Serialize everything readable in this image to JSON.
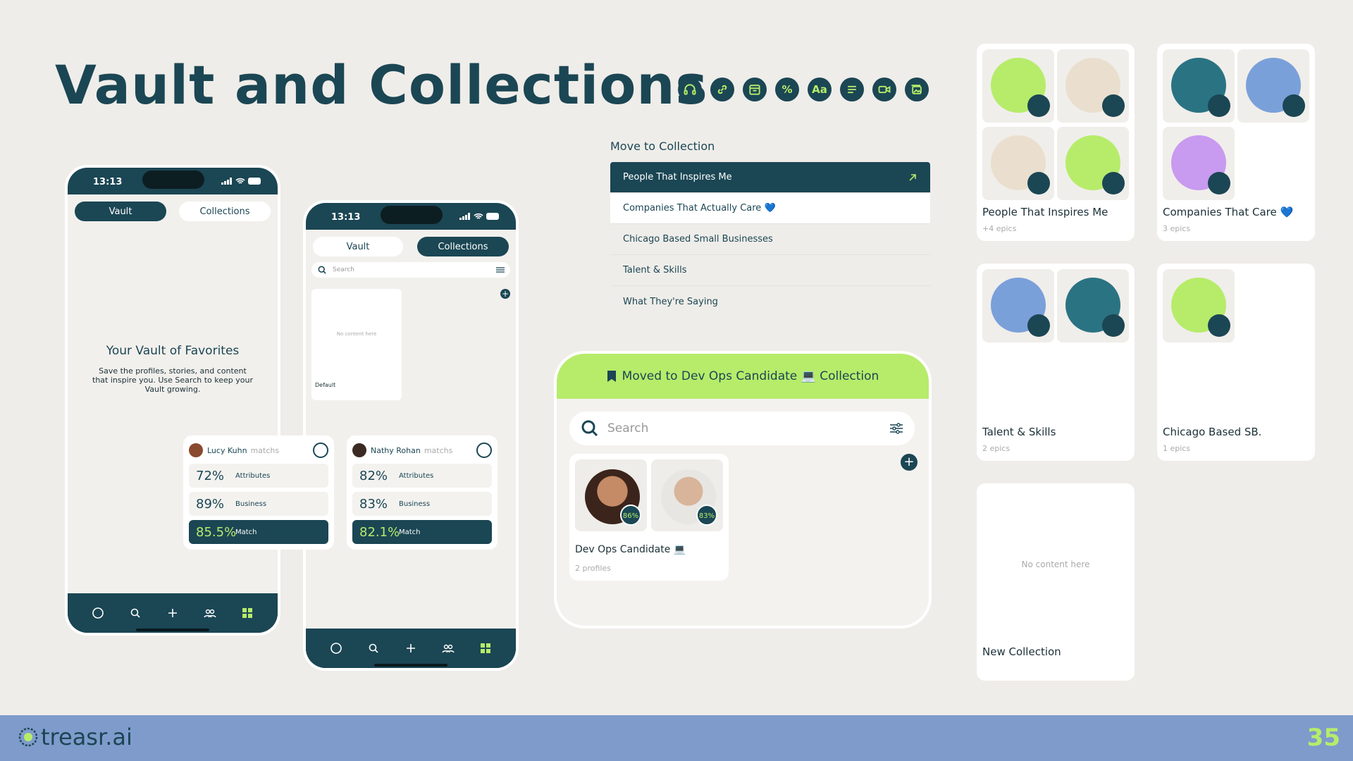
{
  "title": "Vault and Collections",
  "icons": [
    "headphones-icon",
    "link-icon",
    "calendar-icon",
    "percent-icon",
    "text-icon",
    "list-icon",
    "video-icon",
    "gallery-icon"
  ],
  "icon_text_percent": "%",
  "icon_text_aa": "Aa",
  "colors": {
    "primary": "#1b4654",
    "lime": "#b6ec6a",
    "footer": "#7f9bcc"
  },
  "phone1": {
    "time": "13:13",
    "tab_vault": "Vault",
    "tab_collections": "Collections",
    "empty_title": "Your Vault of Favorites",
    "empty_body": "Save the profiles, stories, and content that inspire you. Use Search to keep your Vault growing."
  },
  "phone2": {
    "time": "13:13",
    "tab_vault": "Vault",
    "tab_collections": "Collections",
    "search_placeholder": "Search",
    "empty_card_text": "No content here",
    "default_label": "Default"
  },
  "match_cards": [
    {
      "name": "Lucy Kuhn",
      "sub": "matchs",
      "attributes": "72%",
      "business": "89%",
      "match": "85.5%"
    },
    {
      "name": "Nathy Rohan",
      "sub": "matchs",
      "attributes": "82%",
      "business": "83%",
      "match": "82.1%"
    }
  ],
  "match_labels": {
    "attributes": "Attributes",
    "business": "Business",
    "match": "Match"
  },
  "move_to_collection": {
    "label": "Move to Collection",
    "items": [
      "People That Inspires Me",
      "Companies That Actually Care 💙",
      "Chicago Based Small Businesses",
      "Talent & Skills",
      "What They're Saying"
    ]
  },
  "moved_panel": {
    "banner": "Moved to Dev Ops Candidate 💻 Collection",
    "search_placeholder": "Search",
    "card_title": "Dev Ops Candidate 💻",
    "card_sub": "2 profiles",
    "badges": [
      "86%",
      "83%"
    ]
  },
  "collections": [
    {
      "name": "People That Inspires Me",
      "sub": "+4 epics"
    },
    {
      "name": "Companies That Care 💙",
      "sub": "3 epics"
    },
    {
      "name": "Talent & Skills",
      "sub": "2 epics"
    },
    {
      "name": "Chicago Based SB.",
      "sub": "1 epics"
    },
    {
      "name": "New Collection",
      "empty": "No content here"
    }
  ],
  "footer": {
    "brand": "treasr.ai",
    "page": "35"
  }
}
